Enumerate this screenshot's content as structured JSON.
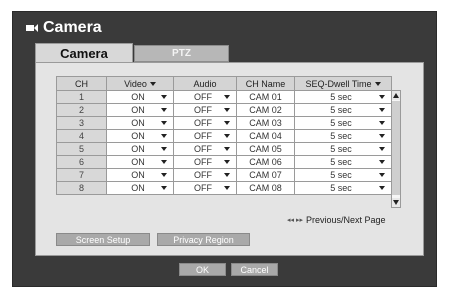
{
  "window": {
    "title": "Camera"
  },
  "tabs": [
    {
      "label": "Camera"
    },
    {
      "label": "PTZ"
    }
  ],
  "table": {
    "headers": {
      "ch": "CH",
      "video": "Video",
      "audio": "Audio",
      "name": "CH Name",
      "dwell": "SEQ-Dwell Time"
    },
    "rows": [
      {
        "ch": "1",
        "video": "ON",
        "audio": "OFF",
        "name": "CAM 01",
        "dwell": "5 sec"
      },
      {
        "ch": "2",
        "video": "ON",
        "audio": "OFF",
        "name": "CAM 02",
        "dwell": "5 sec"
      },
      {
        "ch": "3",
        "video": "ON",
        "audio": "OFF",
        "name": "CAM 03",
        "dwell": "5 sec"
      },
      {
        "ch": "4",
        "video": "ON",
        "audio": "OFF",
        "name": "CAM 04",
        "dwell": "5 sec"
      },
      {
        "ch": "5",
        "video": "ON",
        "audio": "OFF",
        "name": "CAM 05",
        "dwell": "5 sec"
      },
      {
        "ch": "6",
        "video": "ON",
        "audio": "OFF",
        "name": "CAM 06",
        "dwell": "5 sec"
      },
      {
        "ch": "7",
        "video": "ON",
        "audio": "OFF",
        "name": "CAM 07",
        "dwell": "5 sec"
      },
      {
        "ch": "8",
        "video": "ON",
        "audio": "OFF",
        "name": "CAM 08",
        "dwell": "5 sec"
      }
    ]
  },
  "pager": {
    "label": "Previous/Next Page",
    "arrows": "◂◂ ▸▸"
  },
  "buttons": {
    "screen_setup": "Screen Setup",
    "privacy_region": "Privacy Region",
    "ok": "OK",
    "cancel": "Cancel"
  }
}
